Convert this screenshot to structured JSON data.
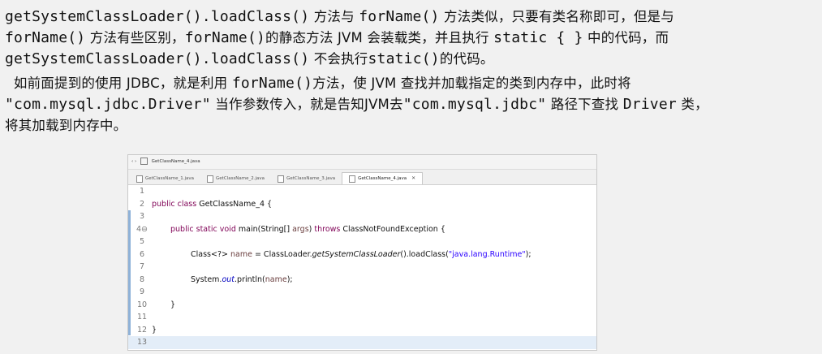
{
  "paragraph1": {
    "line1_a": "getSystemClassLoader().loadClass()",
    "line1_b": " 方法与 ",
    "line1_c": "forName()",
    "line1_d": " 方法类似，只要有类名称即可，但是与",
    "line2_a": "forName()",
    "line2_b": " 方法有些区别，",
    "line2_c": "forName()",
    "line2_d": "的静态方法 JVM 会装载类，并且执行 ",
    "line2_e": "static { }",
    "line2_f": " 中的代码，而",
    "line3_a": "getSystemClassLoader().loadClass()",
    "line3_b": " 不会执行",
    "line3_c": "static()",
    "line3_d": "的代码。"
  },
  "paragraph2": {
    "line1_a": "  如前面提到的使用 JDBC，就是利用 ",
    "line1_b": "forName()",
    "line1_c": "方法，使 JVM 查找并加载指定的类到内存中，此时将",
    "line2_a": "\"com.mysql.jdbc.Driver\"",
    "line2_b": " 当作参数传入，就是告知JVM去",
    "line2_c": "\"com.mysql.jdbc\"",
    "line2_d": " 路径下查找 ",
    "line2_e": "Driver",
    "line2_f": " 类，",
    "line3": "将其加载到内存中。"
  },
  "ide": {
    "breadcrumb": "GetClassName_4.java",
    "tabs": [
      {
        "label": "GetClassName_1.java"
      },
      {
        "label": "GetClassName_2.java"
      },
      {
        "label": "GetClassName_3.java"
      },
      {
        "label": "GetClassName_4.java"
      }
    ],
    "close_glyph": "✕",
    "line_numbers": [
      "1",
      "2",
      "3",
      "4⊖",
      "5",
      "6",
      "7",
      "8",
      "9",
      "10",
      "11",
      "12",
      "13"
    ],
    "code": {
      "l2_kw1": "public",
      "l2_kw2": "class",
      "l2_rest": " GetClassName_4 {",
      "l4_kw1": "public",
      "l4_kw2": "static",
      "l4_kw3": "void",
      "l4_mid": " main(String[] ",
      "l4_param": "args",
      "l4_pre_throws": ") ",
      "l4_kw4": "throws",
      "l4_rest": " ClassNotFoundException {",
      "l6_a": "Class<?> ",
      "l6_var": "name",
      "l6_b": " = ClassLoader.",
      "l6_method": "getSystemClassLoader",
      "l6_c": "().loadClass(",
      "l6_str": "\"java.lang.Runtime\"",
      "l6_d": ");",
      "l8_a": "System.",
      "l8_out": "out",
      "l8_b": ".println(",
      "l8_var": "name",
      "l8_c": ");",
      "l10": "}",
      "l12": "}"
    }
  }
}
